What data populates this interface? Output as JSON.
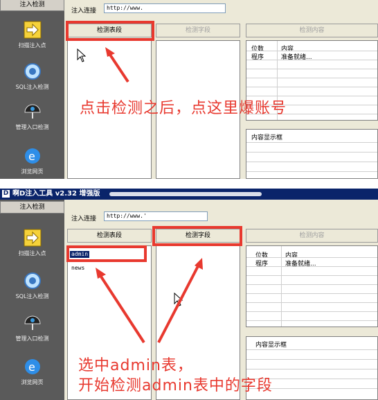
{
  "top": {
    "sidebar_header": "注入检测",
    "sidebar_items": [
      {
        "label": "扫描注入点",
        "icon": "arrow-right-icon"
      },
      {
        "label": "SQL注入检测",
        "icon": "gear-globe-icon"
      },
      {
        "label": "管理入口检测",
        "icon": "umbrella-icon"
      },
      {
        "label": "浏览网页",
        "icon": "ie-globe-icon"
      }
    ],
    "url_label": "注入连接",
    "url_value": "http://www.",
    "tabs": {
      "tables": "检测表段",
      "fields": "检测字段",
      "content": "检测内容"
    },
    "grid": {
      "headers": [
        "位数",
        "内容"
      ],
      "rows": [
        [
          "程序",
          "准备就绪..."
        ]
      ]
    },
    "content_display_title": "内容显示框",
    "annotation": "点击检测之后，点这里爆账号"
  },
  "bottom": {
    "title": "啊D注入工具 v2.32 增强版",
    "sidebar_header": "注入检测",
    "sidebar_items": [
      {
        "label": "扫描注入点",
        "icon": "arrow-right-icon"
      },
      {
        "label": "SQL注入检测",
        "icon": "gear-globe-icon"
      },
      {
        "label": "管理入口检测",
        "icon": "umbrella-icon"
      },
      {
        "label": "浏览网页",
        "icon": "ie-globe-icon"
      }
    ],
    "url_label": "注入连接",
    "url_value": "http://www.'",
    "tabs": {
      "tables": "检测表段",
      "fields": "检测字段",
      "content": "检测内容"
    },
    "table_list": [
      "admin",
      "news"
    ],
    "grid": {
      "headers": [
        "位数",
        "内容"
      ],
      "rows": [
        [
          "程序",
          "准备就绪..."
        ]
      ]
    },
    "content_display_title": "内容显示框",
    "annotation_line1": "选中admin表，",
    "annotation_line2": "开始检测admin表中的字段"
  },
  "colors": {
    "annotation_red": "#e8392f",
    "panel_bg": "#ece9d8",
    "sidebar_bg": "#5a5a5a",
    "selection": "#0a246a"
  }
}
